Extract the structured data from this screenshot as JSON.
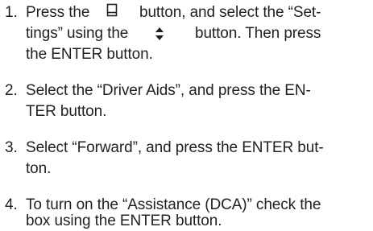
{
  "steps": [
    {
      "number": "1.",
      "l1_a": "Press the",
      "icon_1": "menu-button-icon",
      "l1_b": "button, and select the “Set-",
      "l2_a": "tings” using the",
      "icon_2": "up-down-arrows-icon",
      "l2_b": "button. Then press",
      "l3": "the ENTER button."
    },
    {
      "number": "2.",
      "l1": "Select the “Driver Aids”, and press the EN-",
      "l2": "TER button."
    },
    {
      "number": "3.",
      "l1": "Select “Forward”, and press the ENTER but-",
      "l2": "ton."
    },
    {
      "number": "4.",
      "l1": "To turn on the “Assistance (DCA)” check the",
      "l2": "box using the ENTER button."
    }
  ]
}
